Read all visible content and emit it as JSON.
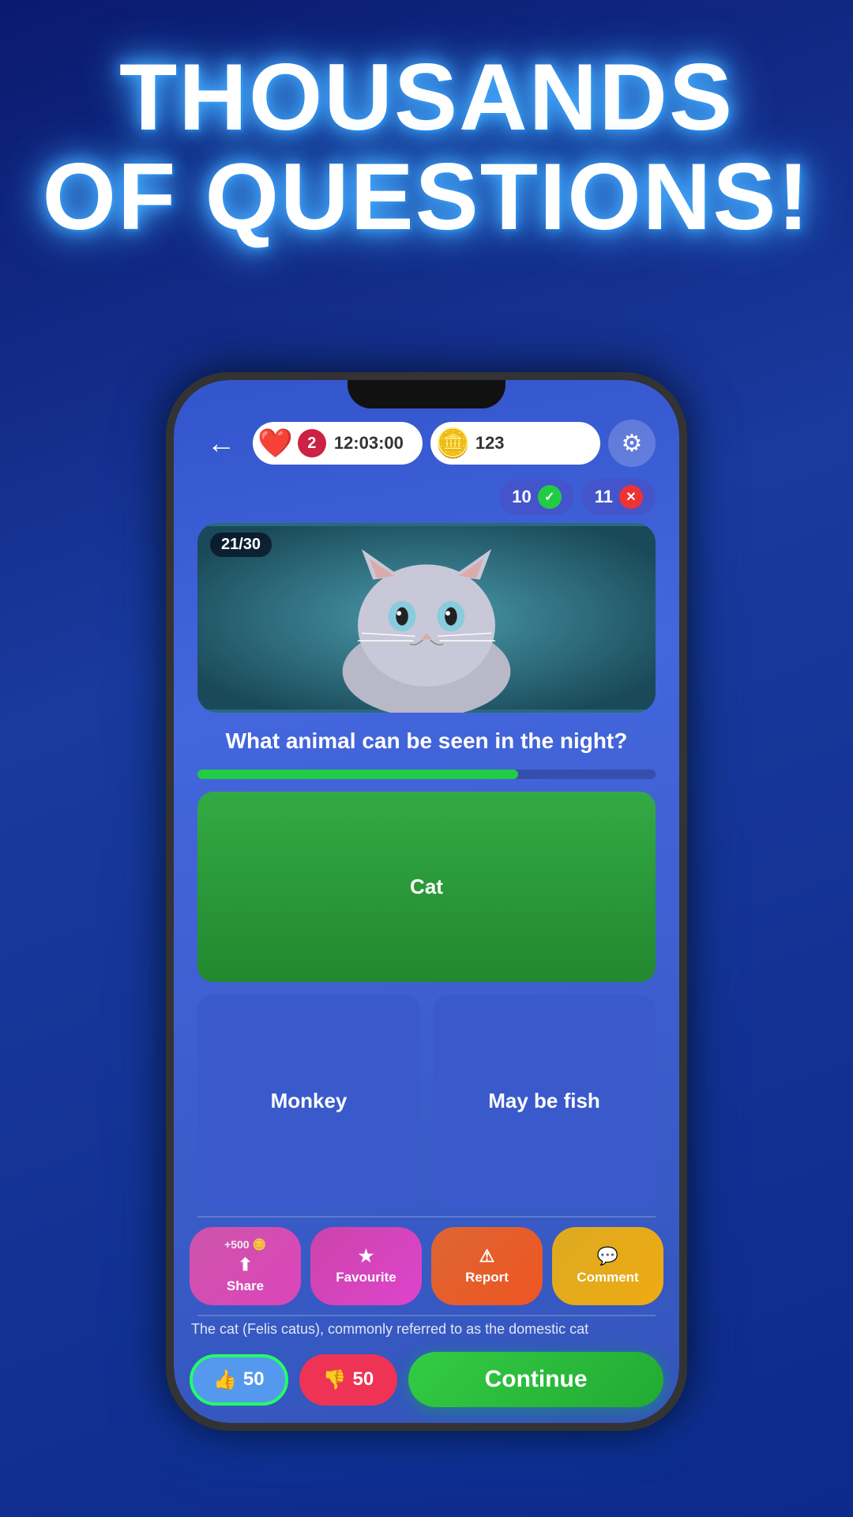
{
  "page": {
    "title_line1": "THOUSANDS",
    "title_line2": "OF QUESTIONS!"
  },
  "topbar": {
    "back_arrow": "←",
    "heart_count": "2",
    "timer": "12:03:00",
    "coin_count": "123",
    "settings_icon": "⚙"
  },
  "scores": {
    "correct_count": "10",
    "wrong_count": "11"
  },
  "question": {
    "counter": "21/30",
    "text": "What animal can be seen in the night?",
    "progress_percent": 70
  },
  "answers": {
    "top": "Cat",
    "bottom_left": "Monkey",
    "bottom_right": "May be fish"
  },
  "actions": {
    "share_bonus": "+500 🪙",
    "share_label": "Share",
    "favourite_label": "Favourite",
    "report_label": "Report",
    "comment_label": "Comment"
  },
  "description": "The cat (Felis catus), commonly referred to as the domestic cat",
  "voting": {
    "upvote_count": "50",
    "downvote_count": "50",
    "continue_label": "Continue"
  },
  "colors": {
    "background": "#1a3a9e",
    "screen_bg": "#3355cc",
    "answer_btn": "#3a5acc",
    "correct_btn": "#33aa44"
  }
}
